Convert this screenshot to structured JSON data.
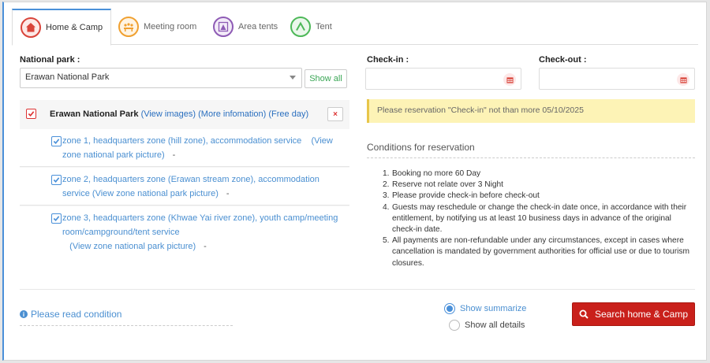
{
  "tabs": [
    {
      "label": "Home & Camp",
      "icon": "home-icon",
      "color": "#d9443a",
      "active": true
    },
    {
      "label": "Meeting room",
      "icon": "meeting-icon",
      "color": "#f0a030",
      "active": false
    },
    {
      "label": "Area tents",
      "icon": "tent-area-icon",
      "color": "#8e5bb5",
      "active": false
    },
    {
      "label": "Tent",
      "icon": "tent-icon",
      "color": "#4db858",
      "active": false
    }
  ],
  "form": {
    "national_park_label": "National park :",
    "national_park_value": "Erawan National Park",
    "show_all": "Show all",
    "checkin_label": "Check-in :",
    "checkout_label": "Check-out :"
  },
  "park": {
    "name": "Erawan National Park",
    "view_images": "(View images)",
    "more_info": "(More infomation)",
    "free_day": "(Free day)",
    "remove": "×",
    "zones": [
      {
        "text": "zone 1, headquarters zone (hill zone), accommodation service",
        "link": "(View zone national park picture)",
        "dash": "-"
      },
      {
        "text": "zone 2, headquarters zone (Erawan stream zone), accommodation service",
        "link": "(View zone national park picture)",
        "dash": "-"
      },
      {
        "text": "zone 3, headquarters zone (Khwae Yai river zone), youth camp/meeting room/campground/tent service",
        "link": "(View zone national park picture)",
        "dash": "-"
      }
    ]
  },
  "notice": "Please reservation \"Check-in\" not than more 05/10/2025",
  "conditions": {
    "title": "Conditions for reservation",
    "items": [
      {
        "n": "1.",
        "text": "Booking no more 60 Day"
      },
      {
        "n": "2.",
        "text": "Reserve not relate over 3 Night"
      },
      {
        "n": "3.",
        "text": "Please provide check-in before check-out"
      },
      {
        "n": "4.",
        "text": "Guests may reschedule or change the check-in date once, in accordance with their entitlement, by notifying us at least 10 business days in advance of the original check-in date."
      },
      {
        "n": "5.",
        "text": "All payments are non-refundable under any circumstances, except in cases where cancellation is mandated by government authorities for official use or due to tourism closures."
      }
    ]
  },
  "footer": {
    "read_condition": "Please read condition",
    "show_summarize": "Show summarize",
    "show_all_details": "Show all details",
    "search_button": "Search home & Camp"
  },
  "colors": {
    "accent": "#4a90d9",
    "search": "#c9201b",
    "notice": "#fdf3b6"
  }
}
